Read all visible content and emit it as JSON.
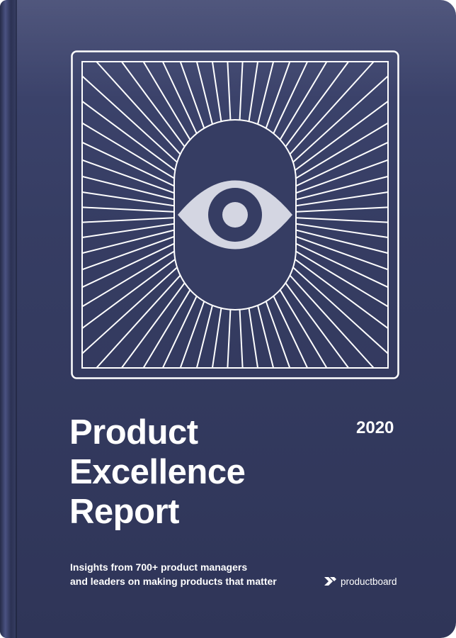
{
  "cover": {
    "title_lines": [
      "Product",
      "Excellence",
      "Report"
    ],
    "year": "2020",
    "subtitle_lines": [
      "Insights from 700+ product managers",
      "and leaders on making products that matter"
    ],
    "brand": "productboard",
    "icons": {
      "artwork": "eye-sunburst-icon",
      "brand_logo": "productboard-logo-icon"
    },
    "colors": {
      "background": "#363d63",
      "line_art": "#ffffff",
      "eye_fill": "#d4d6e2",
      "pupil": "#363d63"
    }
  }
}
